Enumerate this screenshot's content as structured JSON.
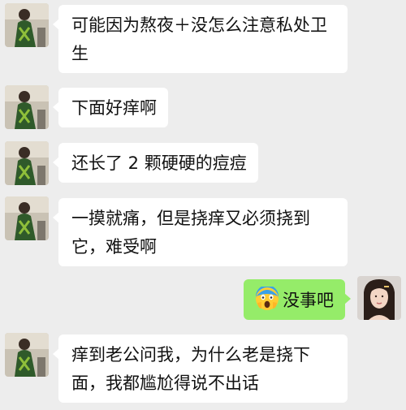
{
  "messages": [
    {
      "side": "left",
      "text": "可能因为熬夜＋没怎么注意私处卫生"
    },
    {
      "side": "left",
      "text": "下面好痒啊"
    },
    {
      "side": "left",
      "text": "还长了 2 颗硬硬的痘痘"
    },
    {
      "side": "left",
      "text": "一摸就痛，但是挠痒又必须挠到它，难受啊"
    },
    {
      "side": "right",
      "emoji": "screaming-face-emoji",
      "text": "没事吧"
    },
    {
      "side": "left",
      "text": "痒到老公问我，为什么老是挠下面，我都尴尬得说不出话"
    }
  ],
  "colors": {
    "background": "#ededed",
    "incoming_bubble": "#ffffff",
    "outgoing_bubble": "#95ec69",
    "text": "#111111"
  }
}
